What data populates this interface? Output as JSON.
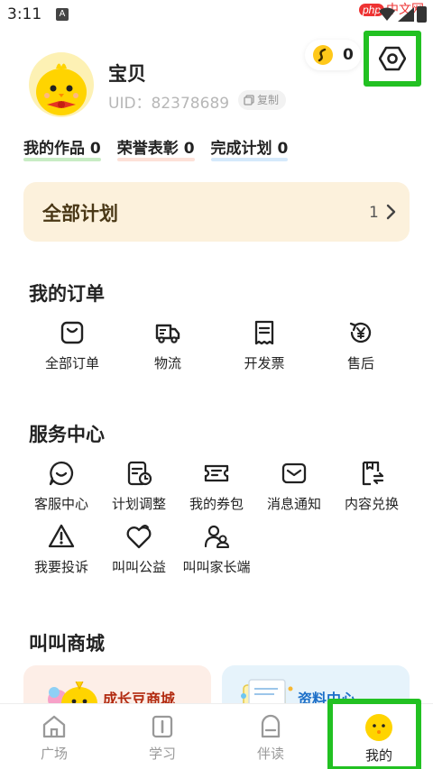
{
  "status_bar": {
    "time": "3:11",
    "notif_letter": "A"
  },
  "watermark": {
    "php": "php",
    "text": "中文网"
  },
  "profile": {
    "nickname": "宝贝",
    "uid": "UID：82378689",
    "copy_label": "复制",
    "coins": "0"
  },
  "stats": [
    {
      "label": "我的作品",
      "value": "0",
      "color": "#c8ecc4"
    },
    {
      "label": "荣誉表彰",
      "value": "0",
      "color": "#fde1d8"
    },
    {
      "label": "完成计划",
      "value": "0",
      "color": "#d5e9fb"
    }
  ],
  "all_plans": {
    "title": "全部计划",
    "count": "1"
  },
  "orders": {
    "title": "我的订单",
    "items": [
      {
        "label": "全部订单",
        "icon": "bag-icon"
      },
      {
        "label": "物流",
        "icon": "truck-icon"
      },
      {
        "label": "开发票",
        "icon": "receipt-icon"
      },
      {
        "label": "售后",
        "icon": "yen-refund-icon"
      }
    ]
  },
  "services": {
    "title": "服务中心",
    "items": [
      {
        "label": "客服中心",
        "icon": "chat-icon"
      },
      {
        "label": "计划调整",
        "icon": "plan-clock-icon"
      },
      {
        "label": "我的券包",
        "icon": "coupon-icon"
      },
      {
        "label": "消息通知",
        "icon": "mail-icon"
      },
      {
        "label": "内容兑换",
        "icon": "exchange-icon"
      },
      {
        "label": "我要投诉",
        "icon": "warning-icon"
      },
      {
        "label": "叫叫公益",
        "icon": "heart-icon"
      },
      {
        "label": "叫叫家长端",
        "icon": "parents-icon"
      }
    ]
  },
  "mall": {
    "title": "叫叫商城",
    "cards": [
      {
        "label": "成长豆商城",
        "color": "#b22a10"
      },
      {
        "label": "资料中心",
        "color": "#1c6fc8"
      }
    ]
  },
  "tabs": [
    {
      "label": "广场",
      "icon": "home-icon"
    },
    {
      "label": "学习",
      "icon": "book-icon"
    },
    {
      "label": "伴读",
      "icon": "companion-icon"
    },
    {
      "label": "我的",
      "icon": "face-icon"
    }
  ],
  "accent": {
    "highlight_box": "#22c122"
  }
}
